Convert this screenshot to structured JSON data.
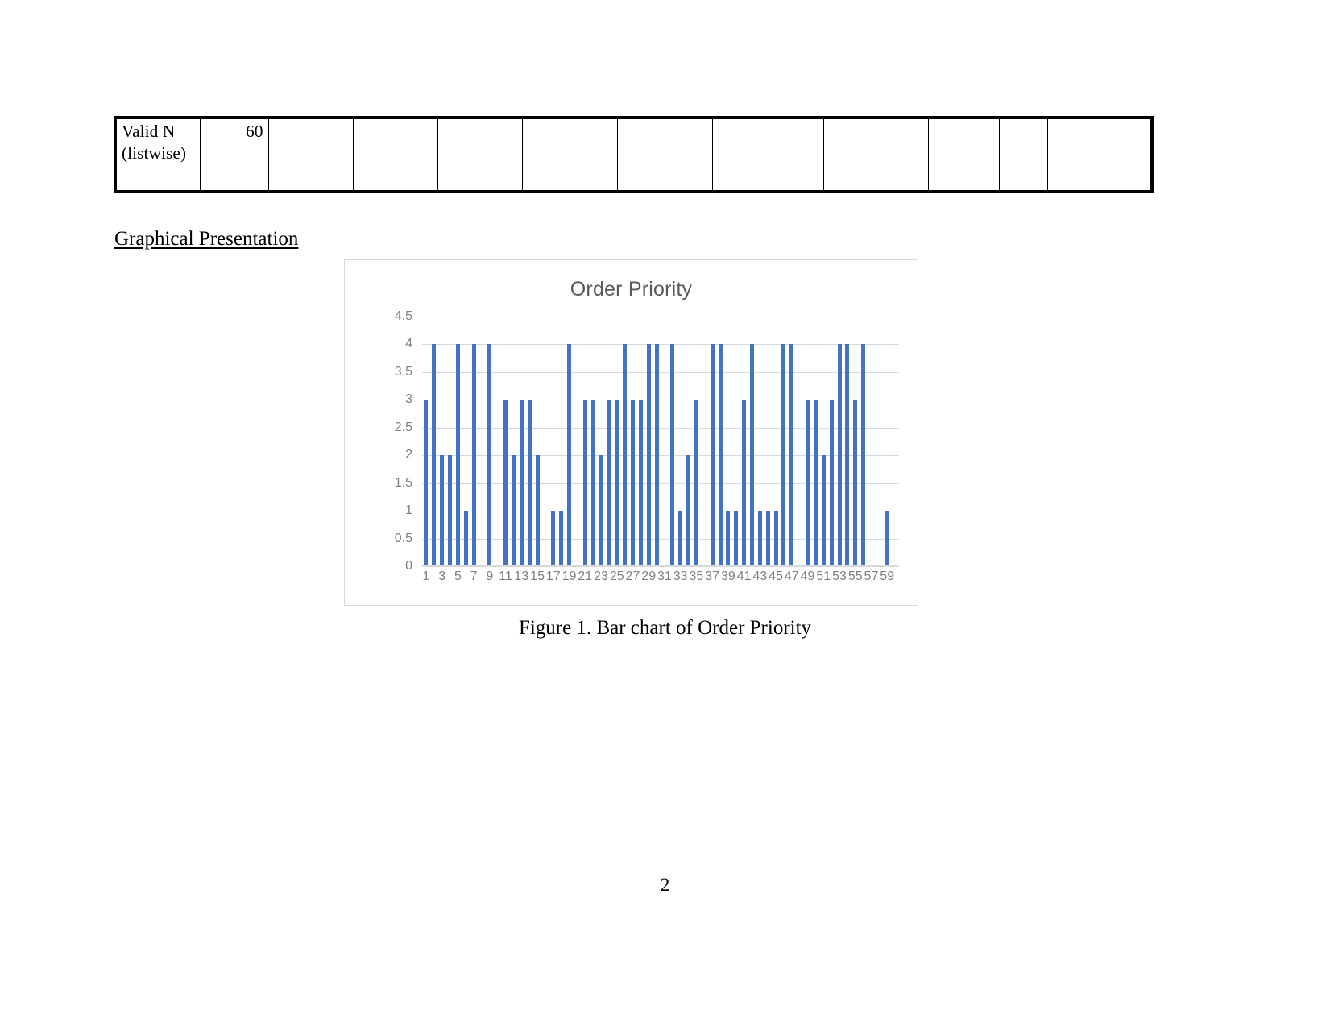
{
  "document": {
    "page_number": "2",
    "section_heading": "Graphical Presentation",
    "figure_caption": "Figure 1. Bar chart of Order Priority"
  },
  "stats_table": {
    "row_label": "Valid N (listwise)",
    "row_value": "60",
    "empty_cell": "",
    "column_count": 13
  },
  "chart_data": {
    "type": "bar",
    "title": "Order Priority",
    "xlabel": "",
    "ylabel": "",
    "ylim": [
      0,
      4.5
    ],
    "ytick_labels": [
      "4.5",
      "4",
      "3.5",
      "3",
      "2.5",
      "2",
      "1.5",
      "1",
      "0.5",
      "0"
    ],
    "ytick_values": [
      4.5,
      4,
      3.5,
      3,
      2.5,
      2,
      1.5,
      1,
      0.5,
      0
    ],
    "xtick_labels": [
      "1",
      "3",
      "5",
      "7",
      "9",
      "11",
      "13",
      "15",
      "17",
      "19",
      "21",
      "23",
      "25",
      "27",
      "29",
      "31",
      "33",
      "35",
      "37",
      "39",
      "41",
      "43",
      "45",
      "47",
      "49",
      "51",
      "53",
      "55",
      "57",
      "59"
    ],
    "grid": true,
    "legend": "none",
    "bar_color": "#4472c4",
    "categories": [
      1,
      2,
      3,
      4,
      5,
      6,
      7,
      8,
      9,
      10,
      11,
      12,
      13,
      14,
      15,
      16,
      17,
      18,
      19,
      20,
      21,
      22,
      23,
      24,
      25,
      26,
      27,
      28,
      29,
      30,
      31,
      32,
      33,
      34,
      35,
      36,
      37,
      38,
      39,
      40,
      41,
      42,
      43,
      44,
      45,
      46,
      47,
      48,
      49,
      50,
      51,
      52,
      53,
      54,
      55,
      56,
      57,
      58,
      59,
      60
    ],
    "values": [
      3,
      4,
      2,
      2,
      4,
      1,
      4,
      0,
      4,
      0,
      3,
      2,
      3,
      3,
      2,
      0,
      1,
      1,
      4,
      0,
      3,
      3,
      2,
      3,
      3,
      4,
      3,
      3,
      4,
      4,
      0,
      4,
      1,
      2,
      3,
      0,
      4,
      4,
      1,
      1,
      3,
      4,
      1,
      1,
      1,
      4,
      4,
      0,
      3,
      3,
      2,
      3,
      4,
      4,
      3,
      4,
      0,
      0,
      1,
      0
    ]
  }
}
